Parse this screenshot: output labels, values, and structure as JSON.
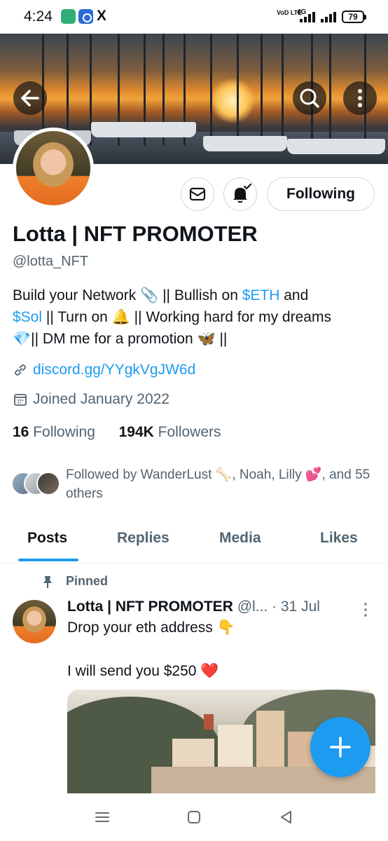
{
  "status_bar": {
    "time": "4:24",
    "network_type": "4G",
    "volte": "VoD LTE",
    "battery": "79"
  },
  "header": {
    "back_icon": "arrow-left-icon",
    "search_icon": "search-icon",
    "more_icon": "more-vertical-icon"
  },
  "profile": {
    "name": "Lotta | NFT PROMOTER",
    "handle": "@lotta_NFT",
    "following_button": "Following",
    "bio": {
      "part1": "Build your Network ",
      "emoji_paperclip": "📎",
      "part2": " || Bullish on ",
      "cashtag_eth": "$ETH",
      "part3": " and",
      "cashtag_sol": "$Sol",
      "part4": " || Turn on ",
      "emoji_bell": "🔔",
      "part5": " || Working hard for my dreams",
      "emoji_gem": "💎",
      "part6": "|| DM me for a promotion ",
      "emoji_butterfly": "🦋",
      "part7": " ||"
    },
    "link": "discord.gg/YYgkVgJW6d",
    "joined": "Joined January 2022",
    "following_count": "16",
    "following_label": "Following",
    "followers_count": "194K",
    "followers_label": "Followers",
    "followed_by": "Followed by WanderLust 🦴, Noah, Lilly 💕, and 55 others"
  },
  "tabs": [
    {
      "label": "Posts",
      "active": true
    },
    {
      "label": "Replies",
      "active": false
    },
    {
      "label": "Media",
      "active": false
    },
    {
      "label": "Likes",
      "active": false
    }
  ],
  "post": {
    "pinned_label": "Pinned",
    "author_name": "Lotta | NFT PROMOTER",
    "author_handle": "@l...",
    "date": "· 31 Jul",
    "line1": "Drop your eth address 👇",
    "line2": "I will send you $250 ❤️"
  },
  "fab_icon": "plus-icon",
  "nav": {
    "recents_icon": "recents-icon",
    "home_icon": "home-icon",
    "back_icon": "back-triangle-icon"
  },
  "colors": {
    "accent": "#1d9bf0",
    "text_primary": "#0f1419",
    "text_secondary": "#536471",
    "border": "#cfd9de"
  }
}
